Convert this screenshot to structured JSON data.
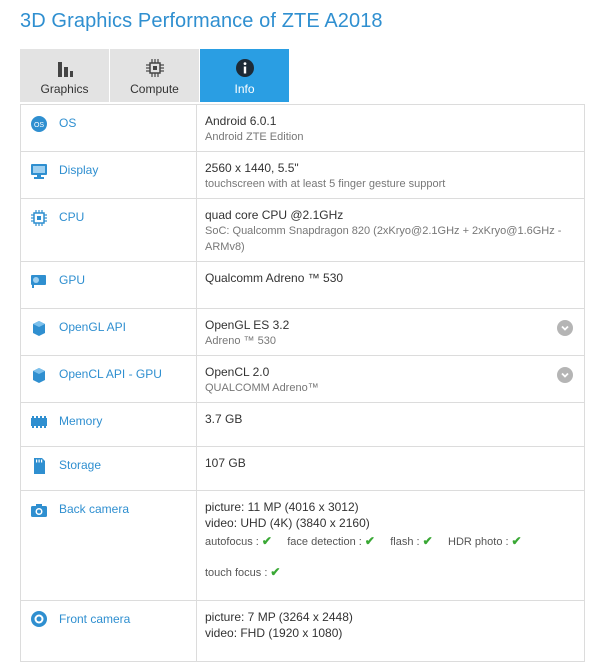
{
  "page": {
    "title": "3D Graphics Performance of ZTE A2018"
  },
  "tabs": [
    {
      "label": "Graphics",
      "icon": "bar-chart-icon",
      "active": false
    },
    {
      "label": "Compute",
      "icon": "chip-icon",
      "active": false
    },
    {
      "label": "Info",
      "icon": "info-icon",
      "active": true
    }
  ],
  "colors": {
    "accent": "#2f8fd0",
    "active_tab": "#2a9ee3",
    "check": "#3aa835"
  },
  "rows": {
    "os": {
      "label": "OS",
      "icon": "android-os-icon",
      "main": "Android 6.0.1",
      "sub": "Android ZTE Edition"
    },
    "display": {
      "label": "Display",
      "icon": "monitor-icon",
      "main": "2560 x 1440, 5.5\"",
      "sub": "touchscreen with at least 5 finger gesture support"
    },
    "cpu": {
      "label": "CPU",
      "icon": "cpu-icon",
      "main": "quad core CPU @2.1GHz",
      "sub1": "SoC: Qualcomm Snapdragon 820 (2xKryo@2.1GHz + 2xKryo@1.6GHz -",
      "sub2": "ARMv8)"
    },
    "gpu": {
      "label": "GPU",
      "icon": "gpu-icon",
      "main": "Qualcomm Adreno ™ 530"
    },
    "opengl": {
      "label": "OpenGL API",
      "icon": "cube-icon",
      "main": "OpenGL ES 3.2",
      "sub": "Adreno ™ 530"
    },
    "opencl": {
      "label": "OpenCL API - GPU",
      "icon": "cube-icon",
      "main": "OpenCL 2.0",
      "sub": "QUALCOMM Adreno™"
    },
    "memory": {
      "label": "Memory",
      "icon": "memory-icon",
      "main": "3.7 GB"
    },
    "storage": {
      "label": "Storage",
      "icon": "storage-icon",
      "main": "107 GB"
    },
    "back_camera": {
      "label": "Back camera",
      "icon": "camera-icon",
      "picture": "picture: 11 MP (4016 x 3012)",
      "video": "video: UHD (4K) (3840 x 2160)",
      "features": [
        "autofocus :",
        "face detection :",
        "flash :",
        "HDR photo :"
      ],
      "touch_focus": "touch focus :"
    },
    "front_camera": {
      "label": "Front camera",
      "icon": "front-camera-icon",
      "picture": "picture: 7 MP (3264 x 2448)",
      "video": "video: FHD (1920 x 1080)"
    }
  }
}
